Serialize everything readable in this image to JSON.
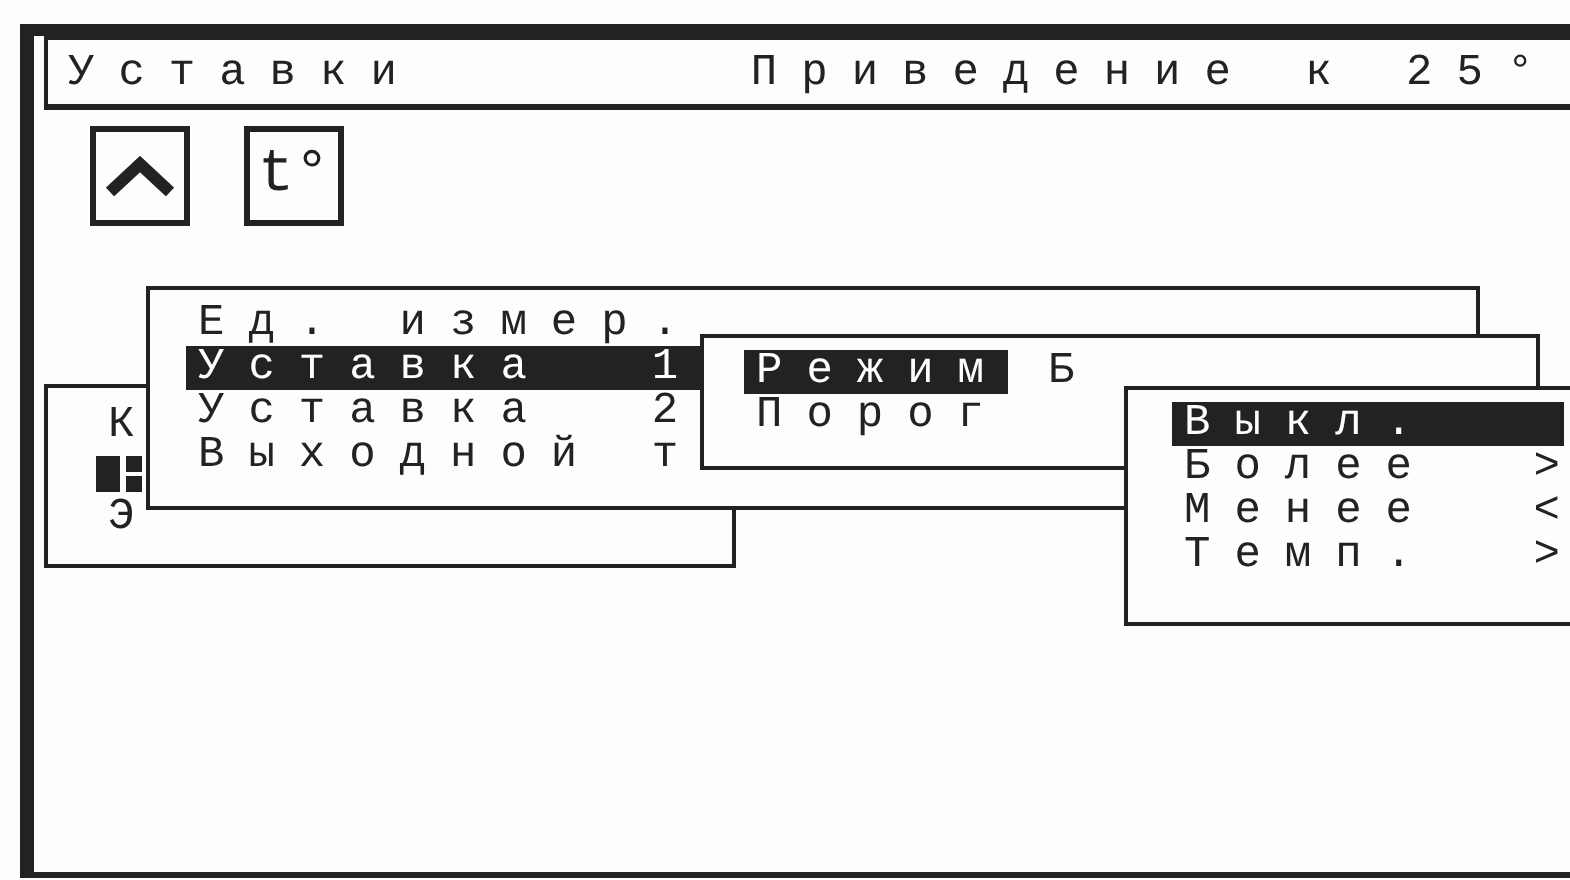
{
  "header": {
    "title": "Уставки",
    "mode": "Приведение к 25°"
  },
  "toolbar": {
    "temp_button": "t°"
  },
  "back_panel": {
    "lines": [
      "К",
      "Э"
    ]
  },
  "menus": [
    {
      "items": [
        {
          "label": "Ед. измер.",
          "selected": false
        },
        {
          "label": "Уставка  1",
          "selected": true
        },
        {
          "label": "Уставка  2",
          "selected": false
        },
        {
          "label": "Выходной т",
          "selected": false
        }
      ]
    },
    {
      "items": [
        {
          "label": "Режим",
          "value": "Б",
          "selected": true
        },
        {
          "label": "Порог",
          "selected": false
        }
      ]
    },
    {
      "items": [
        {
          "label": "Выкл.",
          "selected": true
        },
        {
          "label": "Более",
          "value": ">",
          "selected": false
        },
        {
          "label": "Менее",
          "value": "<",
          "selected": false
        },
        {
          "label": "Темп.",
          "value": ">",
          "selected": false
        }
      ]
    }
  ]
}
